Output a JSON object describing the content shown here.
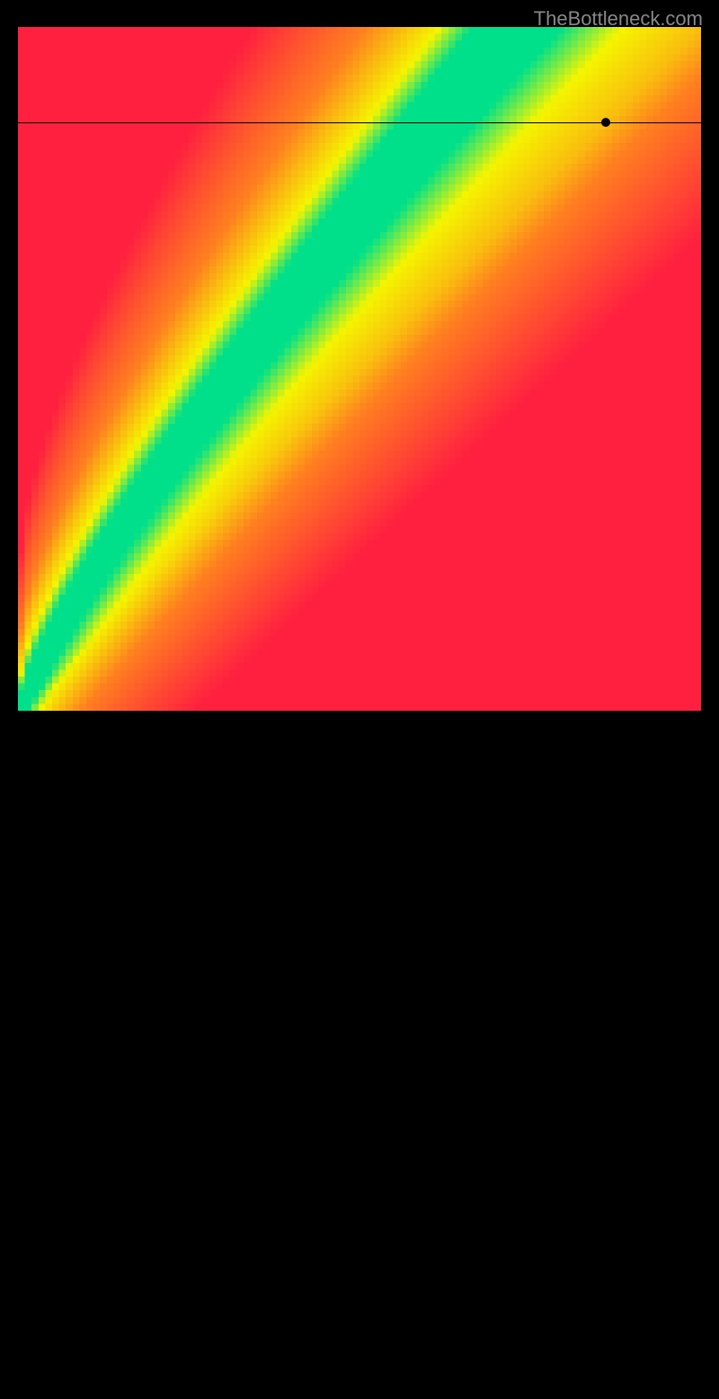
{
  "watermark": "TheBottleneck.com",
  "chart_data": {
    "type": "heatmap",
    "title": "",
    "xlabel": "",
    "ylabel": "",
    "xlim": [
      0,
      100
    ],
    "ylim": [
      0,
      100
    ],
    "marker": {
      "x": 86,
      "y": 86
    },
    "crosshair": {
      "horizontal_y_percent": 14,
      "vertical_x_percent": 86
    },
    "colormap": {
      "description": "Red-Yellow-Green heatmap where green indicates optimal balance diagonal region",
      "optimal_band": {
        "description": "Green diagonal band curving from bottom-left to top-right through center",
        "color": "#00e08a"
      },
      "transition": {
        "color": "#f5f500"
      },
      "bottleneck_regions": {
        "bottom_right": "#ff2040",
        "top_left": "#ff2040",
        "mid": "#ff8020"
      }
    },
    "pixelated": true,
    "grid": false,
    "legend": false
  }
}
